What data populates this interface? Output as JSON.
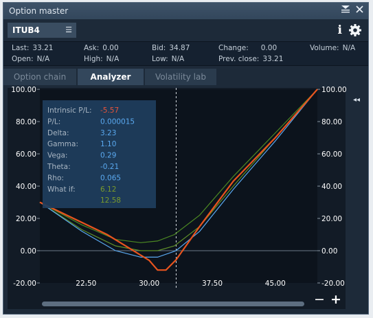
{
  "window": {
    "title": "Option master"
  },
  "toolbar": {
    "symbol": "ITUB4"
  },
  "quotes": {
    "last_label": "Last:",
    "last": "33.21",
    "ask_label": "Ask:",
    "ask": "0.00",
    "bid_label": "Bid:",
    "bid": "34.87",
    "change_label": "Change:",
    "change": "0.00",
    "volume_label": "Volume:",
    "volume": "N/A",
    "open_label": "Open:",
    "open": "N/A",
    "high_label": "High:",
    "high": "N/A",
    "low_label": "Low:",
    "low": "N/A",
    "prev_close_label": "Prev. close:",
    "prev_close": "33.21"
  },
  "tabs": [
    {
      "label": "Option chain",
      "active": false
    },
    {
      "label": "Analyzer",
      "active": true
    },
    {
      "label": "Volatility lab",
      "active": false
    }
  ],
  "tooltip": {
    "rows": [
      {
        "label": "Intrinsic P/L:",
        "value": "-5.57",
        "color": "#e8543a"
      },
      {
        "label": "P/L:",
        "value": "0.000015",
        "color": "#5aa9f0"
      },
      {
        "label": "Delta:",
        "value": "3.23",
        "color": "#5aa9f0"
      },
      {
        "label": "Gamma:",
        "value": "1.10",
        "color": "#5aa9f0"
      },
      {
        "label": "Vega:",
        "value": "0.29",
        "color": "#5aa9f0"
      },
      {
        "label": "Theta:",
        "value": "-0.21",
        "color": "#5aa9f0"
      },
      {
        "label": "Rho:",
        "value": "0.065",
        "color": "#5aa9f0"
      },
      {
        "label": "What if:",
        "value": "6.12",
        "color": "#7a9a2c"
      },
      {
        "label": "",
        "value": "12.58",
        "color": "#7a9a2c"
      }
    ]
  },
  "chart_data": {
    "type": "line",
    "xlim": [
      17.0,
      50.0
    ],
    "ylim": [
      -20,
      100
    ],
    "x_ticks": [
      "22.50",
      "30.00",
      "37.50",
      "45.00"
    ],
    "x_tick_values": [
      22.5,
      30.0,
      37.5,
      45.0
    ],
    "y_ticks": [
      "100.00",
      "80.00",
      "60.00",
      "40.00",
      "20.00",
      "0.00",
      "-20.00"
    ],
    "y_tick_values": [
      100,
      80,
      60,
      40,
      20,
      0,
      -20
    ],
    "current_price": 33.21,
    "grid": false,
    "series": [
      {
        "color": "#e8541e",
        "x": [
          17,
          25,
          30,
          31,
          32,
          33.21,
          36,
          40,
          45,
          50
        ],
        "y": [
          30,
          10,
          -6,
          -12,
          -12,
          -5.6,
          15,
          43,
          70,
          100
        ]
      },
      {
        "color": "#5aa9f0",
        "x": [
          17,
          22,
          26,
          29,
          31,
          33.2,
          36,
          40,
          45,
          50
        ],
        "y": [
          30,
          12,
          0,
          -4,
          -4,
          0,
          12,
          38,
          68,
          100
        ]
      },
      {
        "color": "#5f8f2a",
        "x": [
          17,
          22,
          26,
          29,
          31,
          33,
          36,
          40,
          45,
          50
        ],
        "y": [
          30,
          13,
          3,
          0,
          0,
          3,
          15,
          40,
          70,
          100
        ]
      },
      {
        "color": "#4d8a23",
        "x": [
          17,
          22,
          26,
          29,
          31,
          33,
          36,
          40,
          45,
          50
        ],
        "y": [
          30,
          16,
          7,
          5,
          6,
          10,
          22,
          46,
          73,
          100
        ]
      }
    ]
  },
  "zoom": {
    "minus": "−",
    "plus": "+"
  }
}
